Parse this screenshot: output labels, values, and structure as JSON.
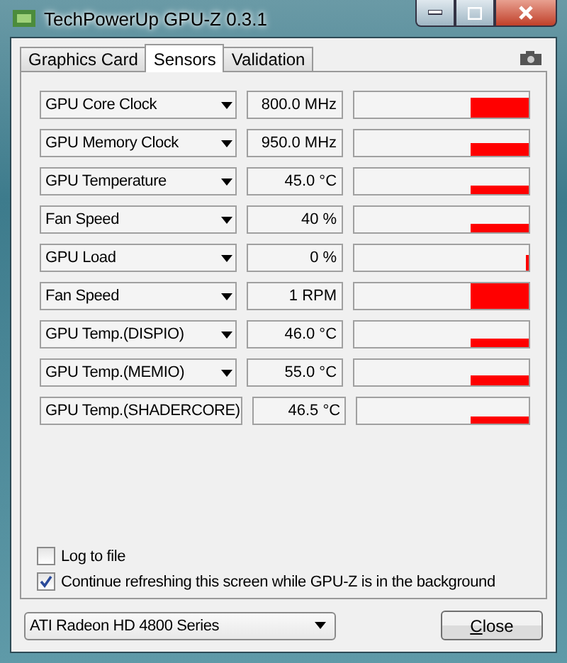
{
  "window": {
    "title": "TechPowerUp GPU-Z 0.3.1"
  },
  "tabs": [
    {
      "label": "Graphics Card",
      "selected": false
    },
    {
      "label": "Sensors",
      "selected": true
    },
    {
      "label": "Validation",
      "selected": false
    }
  ],
  "sensors": [
    {
      "name": "GPU Core Clock",
      "reading": "800.0 MHz"
    },
    {
      "name": "GPU Memory Clock",
      "reading": "950.0 MHz"
    },
    {
      "name": "GPU Temperature",
      "reading": "45.0 °C"
    },
    {
      "name": "Fan Speed",
      "reading": "40 %"
    },
    {
      "name": "GPU Load",
      "reading": "0 %"
    },
    {
      "name": "Fan Speed",
      "reading": "1 RPM"
    },
    {
      "name": "GPU Temp.(DISPIO)",
      "reading": "46.0 °C"
    },
    {
      "name": "GPU Temp.(MEMIO)",
      "reading": "55.0 °C"
    },
    {
      "name": "GPU Temp.(SHADERCORE)",
      "reading": "46.5 °C"
    }
  ],
  "options": [
    {
      "label": "Log to file",
      "checked": false
    },
    {
      "label": "Continue refreshing this screen while GPU-Z is in the background",
      "checked": true
    }
  ],
  "card_select": {
    "value": "ATI Radeon HD 4800 Series"
  },
  "buttons": [
    "Close"
  ]
}
